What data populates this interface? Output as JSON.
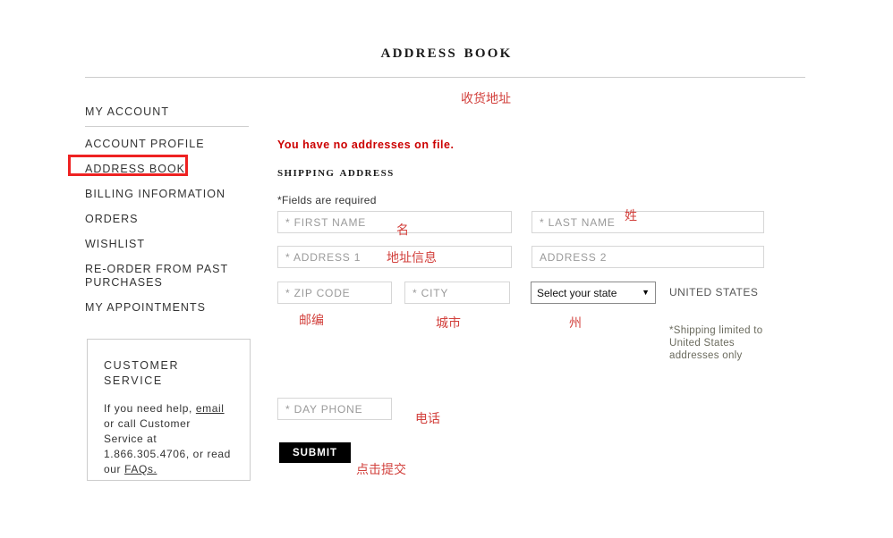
{
  "header": {
    "title": "Address Book"
  },
  "sidebar": {
    "heading": "MY ACCOUNT",
    "items": [
      {
        "label": "ACCOUNT PROFILE",
        "active": false
      },
      {
        "label": "ADDRESS BOOK",
        "active": true
      },
      {
        "label": "BILLING INFORMATION",
        "active": false
      },
      {
        "label": "ORDERS",
        "active": false
      },
      {
        "label": "WISHLIST",
        "active": false
      },
      {
        "label": "RE-ORDER FROM PAST PURCHASES",
        "active": false
      },
      {
        "label": "MY APPOINTMENTS",
        "active": false
      }
    ]
  },
  "customer_service": {
    "title": "CUSTOMER SERVICE",
    "text_before_email": "If you need help, ",
    "email_link": "email",
    "text_after_email": " or call Customer Service at 1.866.305.4706, or read our ",
    "faq_link": "FAQs.",
    "phone": "1.866.305.4706"
  },
  "main": {
    "error_message": "You have no addresses on file.",
    "section_title": "Shipping Address",
    "required_note": "*Fields are required",
    "fields": {
      "first_name": {
        "placeholder": "* FIRST NAME",
        "value": ""
      },
      "last_name": {
        "placeholder": "* LAST NAME",
        "value": ""
      },
      "address1": {
        "placeholder": "* ADDRESS 1",
        "value": ""
      },
      "address2": {
        "placeholder": "ADDRESS 2",
        "value": ""
      },
      "zip_code": {
        "placeholder": "* ZIP CODE",
        "value": ""
      },
      "city": {
        "placeholder": "* CITY",
        "value": ""
      },
      "day_phone": {
        "placeholder": "* DAY PHONE",
        "value": ""
      }
    },
    "state_select": {
      "selected": "Select your state",
      "caret": "▼"
    },
    "country": "UNITED STATES",
    "shipping_note": "*Shipping limited to United States addresses only",
    "submit_label": "SUBMIT"
  },
  "annotations": {
    "top": "收货地址",
    "first_name": "名",
    "last_name": "姓",
    "address1": "地址信息",
    "zip_code": "邮编",
    "city": "城市",
    "state": "州",
    "phone": "电话",
    "submit": "点击提交"
  },
  "colors": {
    "error_red": "#cc0000",
    "annotation_red": "#d2403c",
    "annotation_box_red": "#ee2222",
    "submit_bg": "#000000",
    "text": "#333333"
  }
}
